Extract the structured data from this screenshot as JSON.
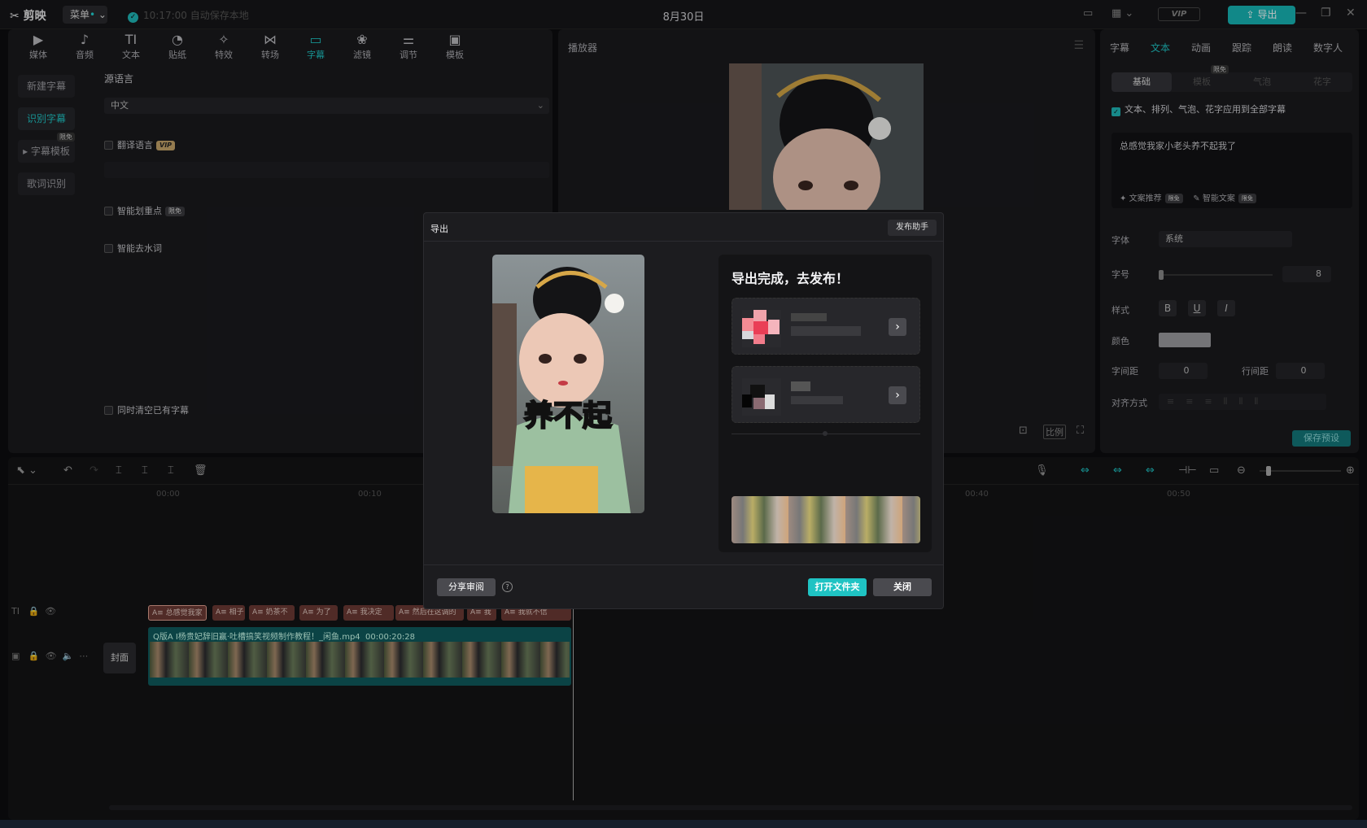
{
  "titlebar": {
    "app_name": "剪映",
    "menu_label": "菜单",
    "autosave": "10:17:00 自动保存本地",
    "doc_title": "8月30日",
    "vip": "VIP",
    "export_label": "导出"
  },
  "tools": [
    "媒体",
    "音频",
    "文本",
    "贴纸",
    "特效",
    "转场",
    "字幕",
    "滤镜",
    "调节",
    "模板"
  ],
  "tool_icons": [
    "media-icon",
    "audio-icon",
    "text-icon",
    "sticker-icon",
    "effects-icon",
    "transition-icon",
    "subtitle-icon",
    "filter-icon",
    "adjust-icon",
    "template-icon"
  ],
  "left_nav": {
    "new_caption": "新建字幕",
    "recognize_caption": "识别字幕",
    "caption_template": "字幕模板",
    "lyrics_recognize": "歌词识别",
    "limited_free": "限免"
  },
  "recognize": {
    "source_lang_label": "源语言",
    "source_lang_value": "中文",
    "translate_label": "翻译语言",
    "vip_tag": "VIP",
    "smart_highlight": "智能划重点",
    "remove_filler": "智能去水词",
    "clear_existing": "同时清空已有字幕"
  },
  "player": {
    "title": "播放器",
    "ratio_label": "比例"
  },
  "right_panel": {
    "tabs": [
      "字幕",
      "文本",
      "动画",
      "跟踪",
      "朗读",
      "数字人"
    ],
    "subtabs": [
      "基础",
      "模板",
      "气泡",
      "花字"
    ],
    "apply_all": "文本、排列、气泡、花字应用到全部字幕",
    "caption_text": "总感觉我家小老头养不起我了",
    "copy_recommend": "文案推荐",
    "smart_copy": "智能文案",
    "font_label": "字体",
    "font_value": "系统",
    "size_label": "字号",
    "size_value": "8",
    "style_label": "样式",
    "color_label": "颜色",
    "letter_spacing_label": "字间距",
    "letter_spacing_value": "0",
    "line_spacing_label": "行间距",
    "line_spacing_value": "0",
    "align_label": "对齐方式",
    "save_preset": "保存预设"
  },
  "timeline": {
    "ruler": [
      "00:00",
      "00:10",
      "00:40",
      "00:50"
    ],
    "cover_label": "封面",
    "text_clips": [
      "总感觉我家",
      "相子",
      "奶茶不",
      "为了",
      "我决定",
      "然后在这调的",
      "我",
      "我就不信"
    ],
    "video_clip_label": "Q版A I杨贵妃辞旧赢·吐槽搞笑视频制作教程！_闲鱼.mp4",
    "video_clip_duration": "00:00:20:28"
  },
  "export_modal": {
    "title": "导出",
    "publish_helper": "发布助手",
    "thumb_caption": "养不起",
    "done_text": "导出完成，去发布！",
    "share_review": "分享审阅",
    "open_folder": "打开文件夹",
    "close": "关闭"
  },
  "colors": {
    "accent": "#1fc3c3",
    "panel_bg": "#1a1a1d",
    "app_bg": "#0d0d0f",
    "text_clip": "#6b3a34",
    "video_clip": "#0f5a5d"
  }
}
